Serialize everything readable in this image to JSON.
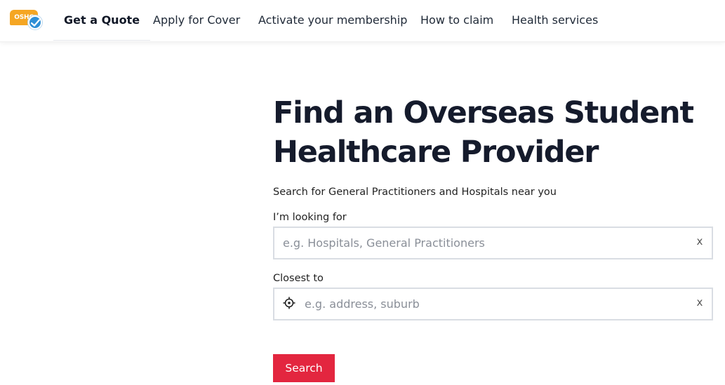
{
  "brand": {
    "logo_text": "OSHC",
    "logo_color": "#f5a623",
    "check_color": "#2f8fd6"
  },
  "nav": {
    "items": [
      {
        "label": "Get a Quote",
        "active": true
      },
      {
        "label": "Apply for Cover"
      },
      {
        "label": "Activate your membership"
      },
      {
        "label": "How to claim"
      },
      {
        "label": "Health services"
      }
    ]
  },
  "main": {
    "title_line1": "Find an Overseas Student",
    "title_line2": "Healthcare Provider",
    "subtitle": "Search for General Practitioners and Hospitals near you",
    "looking_for": {
      "label": "I’m looking for",
      "placeholder": "e.g. Hospitals, General Practitioners",
      "value": "",
      "clear": "x"
    },
    "closest_to": {
      "label": "Closest to",
      "placeholder": "e.g. address, suburb",
      "value": "",
      "clear": "x",
      "icon": "locate-crosshair-icon"
    },
    "search_button": "Search",
    "accent_color": "#e3263f"
  }
}
